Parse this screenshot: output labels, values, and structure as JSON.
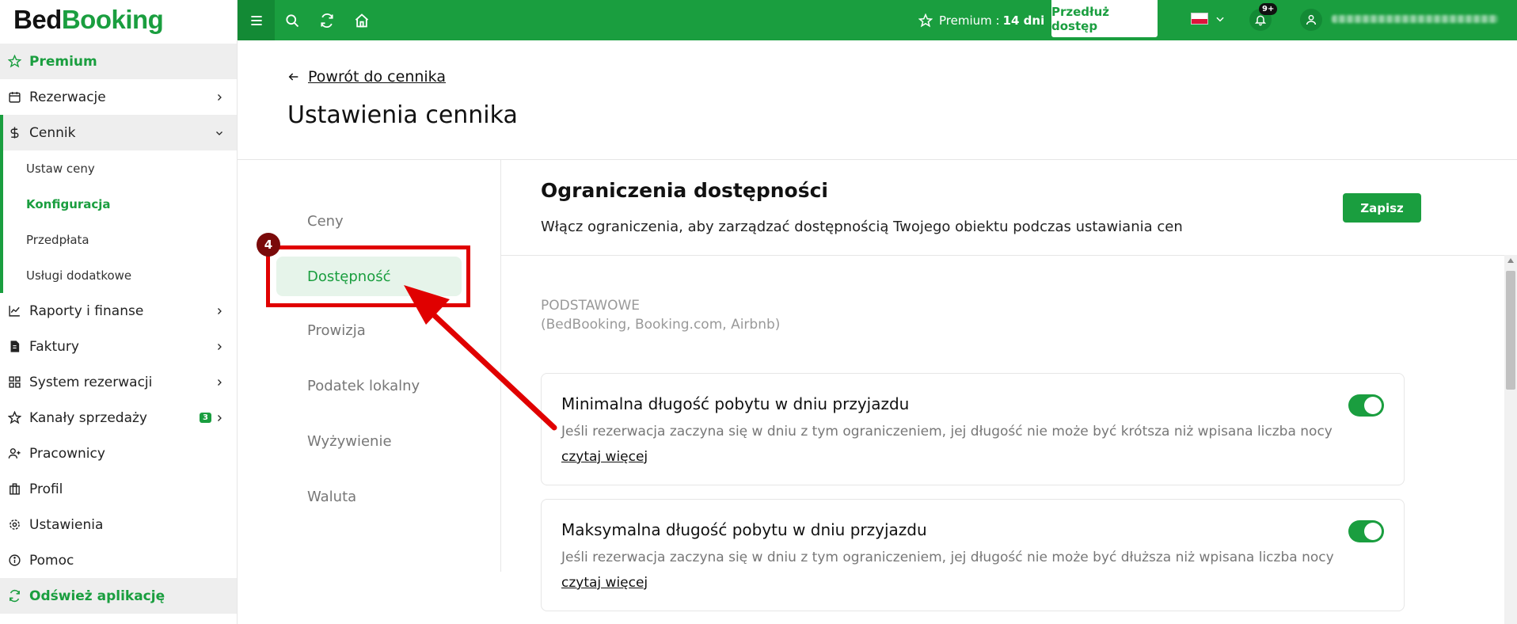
{
  "brand": {
    "part1": "Bed",
    "part2": "Booking"
  },
  "sidebar": {
    "premium": "Premium",
    "items": [
      {
        "label": "Rezerwacje",
        "icon": "calendar-icon"
      },
      {
        "label": "Cennik",
        "icon": "dollar-icon"
      }
    ],
    "submenu": [
      "Ustaw ceny",
      "Konfiguracja",
      "Przedpłata",
      "Usługi dodatkowe"
    ],
    "items2": [
      {
        "label": "Raporty i finanse"
      },
      {
        "label": "Faktury"
      },
      {
        "label": "System rezerwacji"
      },
      {
        "label": "Kanały sprzedaży",
        "badge": "3"
      },
      {
        "label": "Pracownicy"
      },
      {
        "label": "Profil"
      },
      {
        "label": "Ustawienia"
      },
      {
        "label": "Pomoc"
      }
    ],
    "refresh": "Odśwież aplikację"
  },
  "topbar": {
    "premium_label": "Premium :",
    "premium_days": "14 dni",
    "extend_button": "Przedłuż dostęp",
    "notifications_count": "9+"
  },
  "header": {
    "back_link": "Powrót do cennika",
    "title": "Ustawienia cennika"
  },
  "tabs": [
    "Ceny",
    "Dostępność",
    "Prowizja",
    "Podatek lokalny",
    "Wyżywienie",
    "Waluta"
  ],
  "main": {
    "title": "Ograniczenia dostępności",
    "description": "Włącz ograniczenia, aby zarządzać dostępnością Twojego obiektu podczas ustawiania cen",
    "save_button": "Zapisz",
    "group_label": "PODSTAWOWE",
    "group_sub": "(BedBooking, Booking.com, Airbnb)",
    "cards": [
      {
        "title": "Minimalna długość pobytu w dniu przyjazdu",
        "description": "Jeśli rezerwacja zaczyna się w dniu z tym ograniczeniem, jej długość nie może być krótsza niż wpisana liczba nocy",
        "more": "czytaj więcej",
        "enabled": true
      },
      {
        "title": "Maksymalna długość pobytu w dniu przyjazdu",
        "description": "Jeśli rezerwacja zaczyna się w dniu z tym ograniczeniem, jej długość nie może być dłuższa niż wpisana liczba nocy",
        "more": "czytaj więcej",
        "enabled": true
      }
    ]
  },
  "annotation": {
    "step": "4"
  },
  "colors": {
    "accent": "#1a9e3f",
    "annotation": "#e00000"
  }
}
